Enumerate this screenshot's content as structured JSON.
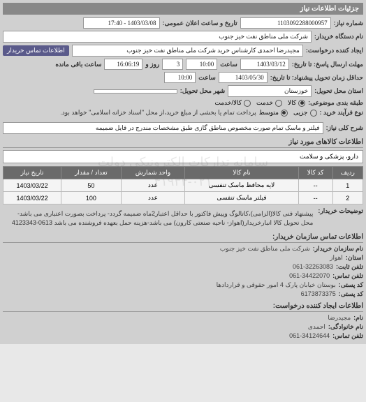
{
  "header": {
    "title": "جزئیات اطلاعات نیاز"
  },
  "form": {
    "request_number_label": "شماره نیاز:",
    "request_number": "1103092288000957",
    "announce_datetime_label": "تاریخ و ساعت اعلان عمومی:",
    "announce_datetime": "1403/03/08 - 17:40",
    "buyer_org_label": "نام دستگاه خریدار:",
    "buyer_org": "شرکت ملی مناطق نفت خیز جنوب",
    "creator_label": "ایجاد کننده درخواست:",
    "creator": "مجیدرضا احمدی  کارشناس خرید  شرکت ملی مناطق نفت خیز جنوب",
    "buyer_contact_badge": "اطلاعات تماس خریدار",
    "deadline_label": "مهلت ارسال پاسخ: تا تاریخ:",
    "deadline_date": "1403/03/12",
    "time_label": "ساعت",
    "deadline_time": "10:00",
    "days_label": "روز و",
    "days_remain": "3",
    "hours_remain_label": "ساعت باقی مانده",
    "hours_remain": "16:06:19",
    "delivery_deadline_label": "حداقل زمان تحویل پیشنهاد: تا تاریخ:",
    "delivery_date": "1403/05/30",
    "delivery_time": "10:00",
    "province_label": "استان محل تحویل:",
    "province": "خوزستان",
    "city_label": "شهر محل تحویل:",
    "city": "",
    "packaging_label": "طبقه بندی موضوعی:",
    "pkg_opt1": "کالا",
    "pkg_opt2": "خدمت",
    "pkg_opt3": "کالا/خدمت",
    "process_label": "نوع فرآیند خرید :",
    "proc_opt1": "جزیی",
    "proc_opt2": "متوسط",
    "proc_note": "پرداخت تمام یا بخشی از مبلغ خرید،از محل \"اسناد خزانه اسلامی\" خواهد بود.",
    "desc_label": "شرح کلی نیاز:",
    "desc": "فیلتر و ماسک تمام صورت مخصوص مناطق گازی طبق مشخصات مندرج در فایل ضمیمه"
  },
  "items_section": {
    "title": "اطلاعات کالاهای مورد نیاز",
    "category": "دارو، پزشکی و سلامت",
    "columns": [
      "ردیف",
      "کد کالا",
      "نام کالا",
      "واحد شمارش",
      "تعداد / مقدار",
      "تاریخ نیاز"
    ],
    "rows": [
      {
        "n": "1",
        "code": "--",
        "name": "لایه محافظ ماسک تنفسی",
        "unit": "عدد",
        "qty": "50",
        "date": "1403/03/22"
      },
      {
        "n": "2",
        "code": "--",
        "name": "فیلتر ماسک تنفسی",
        "unit": "عدد",
        "qty": "100",
        "date": "1403/03/22"
      }
    ],
    "notes_label": "توضیحات خریدار:",
    "notes": "پیشنهاد فنی کالا(الزامی)،کاتالوگ وپیش فاکتور با حداقل اعتبار2ماه ضمیمه گردد- پرداخت بصورت اعتباری می باشد- محل تحویل کالا انبارخریدار(اهواز- ناحیه صنعتی کارون) می باشد-هزینه حمل بعهده فروشنده می باشد 0613-4123343"
  },
  "contact": {
    "title": "اطلاعات تماس سازمان خریدار:",
    "org_label": "نام سازمان خریدار:",
    "org": "شرکت ملی مناطق نفت خیز جنوب",
    "prov_label": "استان:",
    "prov": "اهواز",
    "phone_label": "تلفن ثابت:",
    "phone": "061-32263083",
    "fax_label": "تلفن تماس:",
    "fax": "061-34422070",
    "postal_label": "کد پستی:",
    "postal": "بوستان خیابان پارک 4 امور حقوقی و قراردادها",
    "postal_code_label": "کد پستی:",
    "postal_code": "6173873375",
    "creator_title": "اطلاعات ایجاد کننده درخواست:",
    "name_label": "نام:",
    "name": "مجیدرضا",
    "family_label": "نام خانوادگی:",
    "family": "احمدی",
    "creator_phone_label": "تلفن تماس:",
    "creator_phone": "061-34124644"
  },
  "watermark": "سامانه تدارکات الکترونیکی دولت\n۰۲۱-۴۱۹۳۴"
}
